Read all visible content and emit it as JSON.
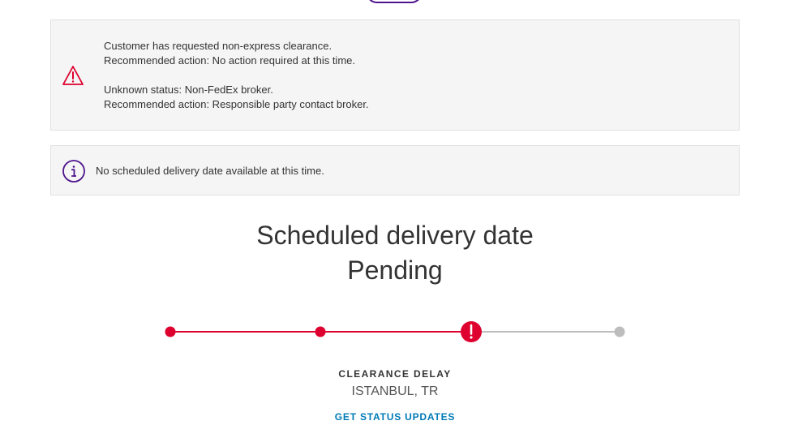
{
  "alerts": {
    "warning": {
      "lines": [
        "Customer has requested non-express clearance.",
        "Recommended action: No action required at this time.",
        "Unknown status: Non-FedEx broker.",
        "Recommended action: Responsible party contact broker."
      ],
      "icon": "warning-triangle-icon",
      "color": "#de002e"
    },
    "info": {
      "text": "No scheduled delivery date available at this time.",
      "icon": "info-circle-icon",
      "color": "#4d148c"
    }
  },
  "delivery": {
    "title": "Scheduled delivery date",
    "status": "Pending"
  },
  "progress": {
    "total_steps": 4,
    "completed_steps": 2,
    "current_step": 3,
    "current_step_state": "exception",
    "active_color": "#de002e",
    "inactive_color": "#bdbdbd"
  },
  "status": {
    "label": "CLEARANCE DELAY",
    "location": "ISTANBUL, TR",
    "link": "GET STATUS UPDATES"
  },
  "colors": {
    "brand_purple": "#4d148c",
    "alert_red": "#de002e",
    "link_blue": "#007ab7"
  }
}
